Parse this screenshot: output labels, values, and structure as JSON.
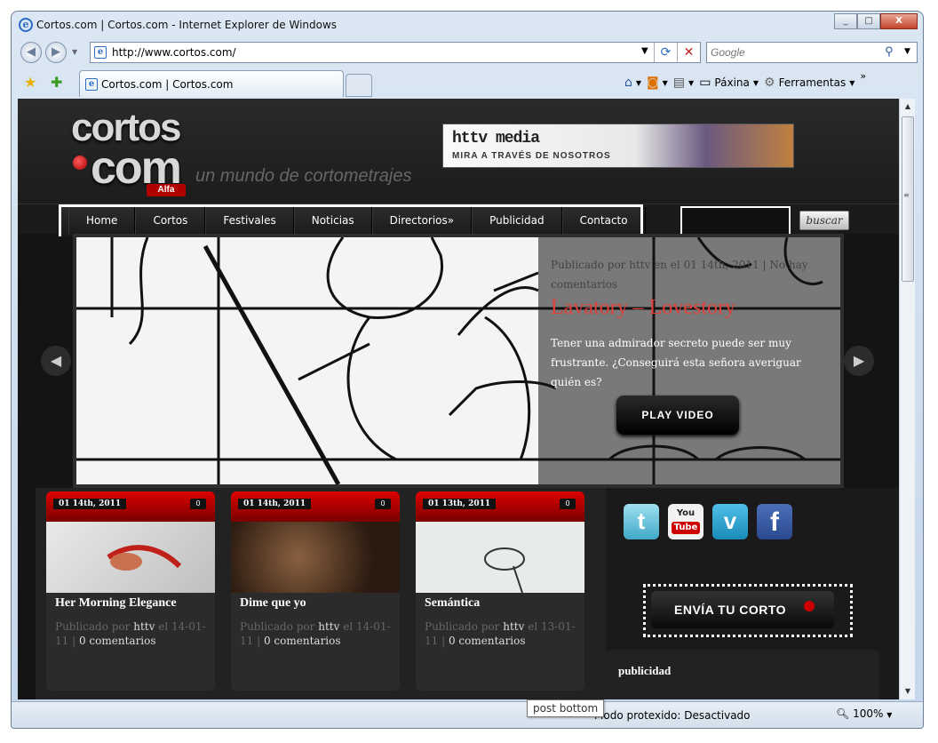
{
  "window": {
    "title": "Cortos.com | Cortos.com - Internet Explorer de Windows",
    "minimize": "_",
    "maximize": "□",
    "close": "X"
  },
  "address": {
    "url": "http://www.cortos.com/"
  },
  "search": {
    "placeholder": "Google"
  },
  "tab": {
    "label": "Cortos.com | Cortos.com"
  },
  "commands": {
    "page": "Páxina",
    "tools": "Ferramentas",
    "more": "»"
  },
  "status": {
    "protected_mode": "Modo protexido: Desactivado",
    "zoom": "100%",
    "tooltip": "post bottom"
  },
  "site": {
    "logo_line1": "cortos",
    "logo_line2": "com",
    "logo_badge": "Alfa",
    "tagline": "un mundo de cortometrajes",
    "banner_brand": "httv media",
    "banner_slogan": "MIRA A TRAVÉS DE NOSOTROS",
    "nav": [
      "Home",
      "Cortos",
      "Festivales",
      "Noticias",
      "Directorios»",
      "Publicidad",
      "Contacto"
    ],
    "search_button": "buscar",
    "featured": {
      "meta": "Publicado por httv en el 01 14th, 2011 | No hay comentarios",
      "title": "Lavatory – Lovestory",
      "excerpt": "Tener una admirador secreto puede ser muy frustrante. ¿Conseguirá esta señora averiguar quién es?",
      "button": "PLAY VIDEO"
    },
    "arrow_prev": "◀",
    "arrow_next": "▶",
    "cards": [
      {
        "date": "01 14th, 2011",
        "comments": "0",
        "title": "Her Morning Elegance",
        "pub": "Publicado por",
        "author": "httv",
        "when": "el 14-01-11",
        "sep": "|",
        "comments_text": "0 comentarios"
      },
      {
        "date": "01 14th, 2011",
        "comments": "0",
        "title": "Dime que yo",
        "pub": "Publicado por",
        "author": "httv",
        "when": "el 14-01-11",
        "sep": "|",
        "comments_text": "0 comentarios"
      },
      {
        "date": "01 13th, 2011",
        "comments": "0",
        "title": "Semántica",
        "pub": "Publicado por",
        "author": "httv",
        "when": "el 13-01-11",
        "sep": "|",
        "comments_text": "0 comentarios"
      }
    ],
    "social": {
      "twitter": "t",
      "youtube_top": "You",
      "youtube_bottom": "Tube",
      "vimeo": "v",
      "facebook": "f"
    },
    "send_button": "ENVÍA TU CORTO",
    "publicidad": "publicidad"
  }
}
